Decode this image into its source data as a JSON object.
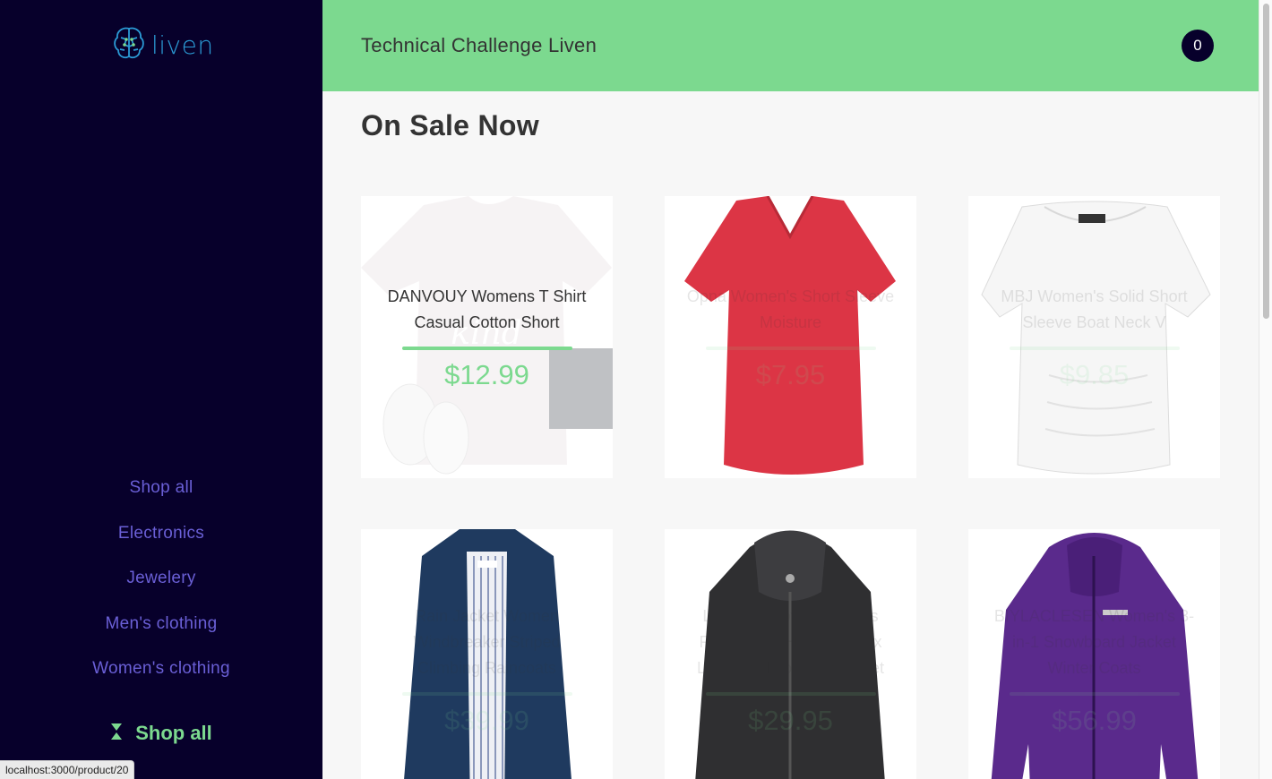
{
  "brand": {
    "name": "liven"
  },
  "header": {
    "title": "Technical Challenge Liven",
    "cart_count": "0"
  },
  "sidebar": {
    "items": [
      {
        "label": "Shop all"
      },
      {
        "label": "Electronics"
      },
      {
        "label": "Jewelery"
      },
      {
        "label": "Men's clothing"
      },
      {
        "label": "Women's clothing"
      }
    ],
    "active": {
      "label": "Shop all",
      "icon": "hourglass-icon"
    }
  },
  "main": {
    "title": "On Sale Now",
    "products": [
      {
        "name": "DANVOUY Womens T Shirt Casual Cotton Short",
        "price": "$12.99"
      },
      {
        "name": "Opna Women's Short Sleeve Moisture",
        "price": "$7.95"
      },
      {
        "name": "MBJ Women's Solid Short Sleeve Boat Neck V",
        "price": "$9.85"
      },
      {
        "name": "Rain Jacket Women Windbreaker Striped Climbing Raincoats",
        "price": "$39.99"
      },
      {
        "name": "Lock and Love Women's Removable Hooded Faux Leather Moto Biker Jacket",
        "price": "$29.95"
      },
      {
        "name": "BIYLACLESEN Women's 3-in-1 Snowboard Jacket Winter Coats",
        "price": "$56.99"
      }
    ]
  },
  "status_bar": {
    "url": "localhost:3000/product/20"
  },
  "colors": {
    "sidebar_bg": "#07002b",
    "accent_green": "#7cd98f",
    "nav_purple": "#6a5fd6",
    "logo_blue": "#2b9bd6"
  }
}
